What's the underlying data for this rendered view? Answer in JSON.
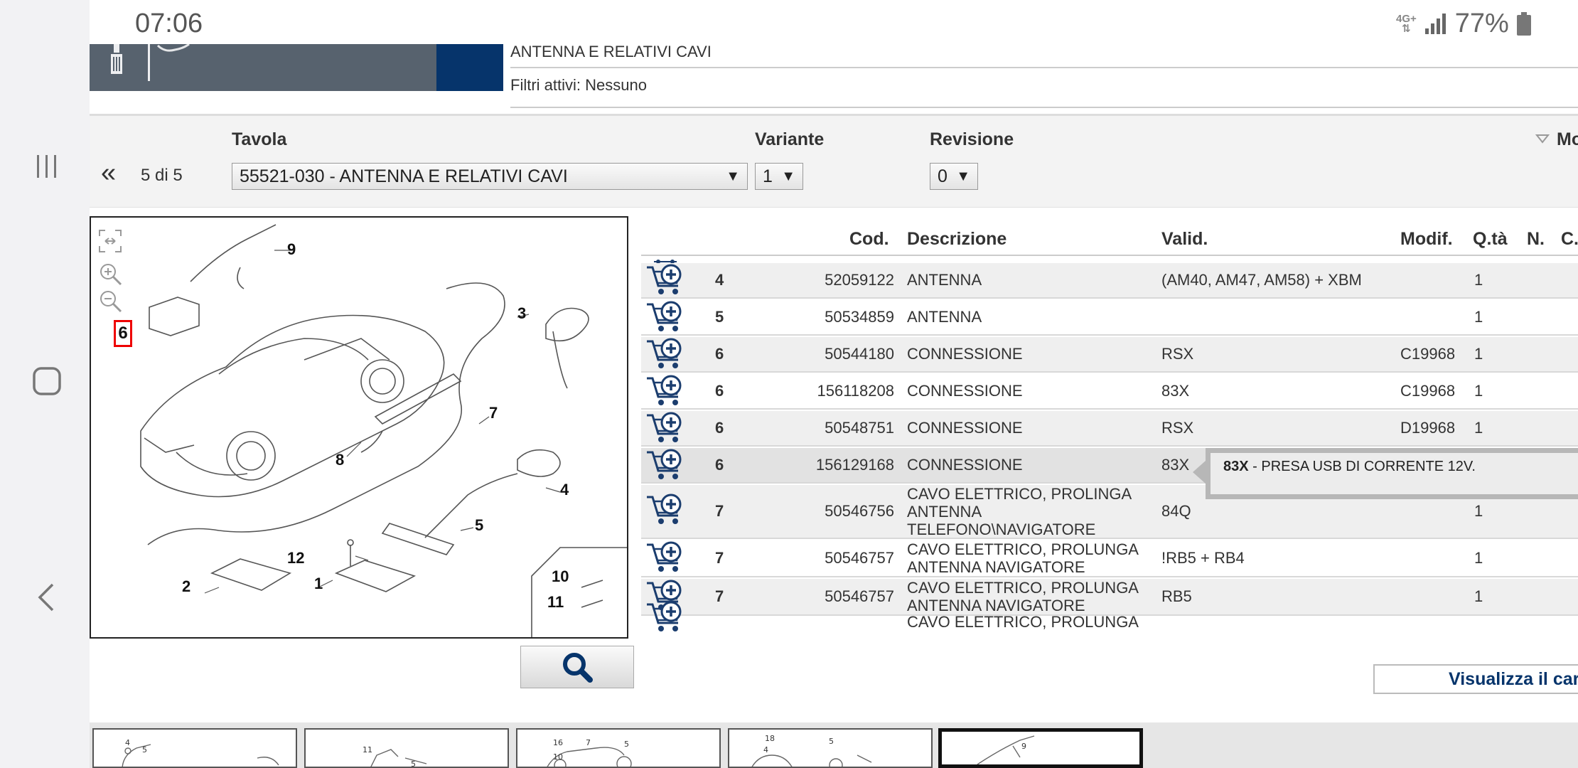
{
  "status": {
    "time": "07:06",
    "network": "4G+",
    "battery": "77%"
  },
  "header": {
    "title": "ANTENNA E RELATIVI CAVI",
    "filters": "Filtri attivi: Nessuno"
  },
  "selector": {
    "tavola_label": "Tavola",
    "variante_label": "Variante",
    "revisione_label": "Revisione",
    "more_label": "Mo",
    "prev": "«",
    "page_count": "5 di 5",
    "tavola_value": "55521-030 - ANTENNA E RELATIVI CAVI",
    "variante_value": "1",
    "revisione_value": "0"
  },
  "diagram": {
    "callouts": [
      "9",
      "3",
      "7",
      "8",
      "4",
      "5",
      "12",
      "2",
      "1",
      "10",
      "11"
    ],
    "selected_callout": "6"
  },
  "table": {
    "headers": {
      "cod": "Cod.",
      "desc": "Descrizione",
      "valid": "Valid.",
      "modif": "Modif.",
      "qta": "Q.tà",
      "n": "N.",
      "c": "C."
    },
    "rows": [
      {
        "tav": "4",
        "cod": "52059122",
        "desc": [
          "ANTENNA"
        ],
        "valid": "(AM40, AM47, AM58) + XBM",
        "modif": "",
        "qta": "1"
      },
      {
        "tav": "5",
        "cod": "50534859",
        "desc": [
          "ANTENNA"
        ],
        "valid": "",
        "modif": "",
        "qta": "1"
      },
      {
        "tav": "6",
        "cod": "50544180",
        "desc": [
          "CONNESSIONE"
        ],
        "valid": "RSX",
        "modif": "C19968",
        "qta": "1"
      },
      {
        "tav": "6",
        "cod": "156118208",
        "desc": [
          "CONNESSIONE"
        ],
        "valid": "83X",
        "modif": "C19968",
        "qta": "1"
      },
      {
        "tav": "6",
        "cod": "50548751",
        "desc": [
          "CONNESSIONE"
        ],
        "valid": "RSX",
        "modif": "D19968",
        "qta": "1"
      },
      {
        "tav": "6",
        "cod": "156129168",
        "desc": [
          "CONNESSIONE"
        ],
        "valid": "83X",
        "modif": "",
        "qta": ""
      },
      {
        "tav": "7",
        "cod": "50546756",
        "desc": [
          "CAVO ELETTRICO, PROLINGA",
          "ANTENNA",
          "TELEFONO\\NAVIGATORE"
        ],
        "valid": "84Q",
        "modif": "",
        "qta": "1"
      },
      {
        "tav": "7",
        "cod": "50546757",
        "desc": [
          "CAVO ELETTRICO, PROLUNGA",
          "ANTENNA NAVIGATORE"
        ],
        "valid": "!RB5 + RB4",
        "modif": "",
        "qta": "1"
      },
      {
        "tav": "7",
        "cod": "50546757",
        "desc": [
          "CAVO ELETTRICO, PROLUNGA",
          "ANTENNA NAVIGATORE"
        ],
        "valid": "RB5",
        "modif": "",
        "qta": "1"
      },
      {
        "tav": "",
        "cod": "",
        "desc": [
          "CAVO ELETTRICO, PROLUNGA"
        ],
        "valid": "",
        "modif": "",
        "qta": ""
      }
    ]
  },
  "tooltip": {
    "code": "83X",
    "text": " - PRESA USB DI CORRENTE 12V."
  },
  "view_cart_label": "Visualizza il car",
  "colors": {
    "header_dark": "#57626e",
    "header_blue": "#06346b",
    "tooltip_border": "#b7b7b7"
  }
}
